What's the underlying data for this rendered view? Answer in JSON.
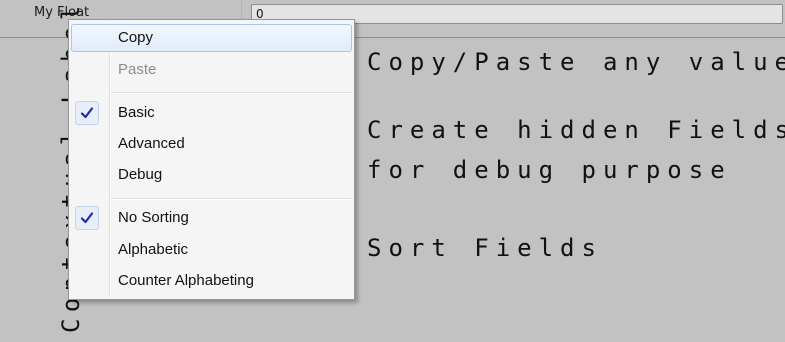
{
  "inspector": {
    "field_label": "My Float",
    "field_value": "0"
  },
  "vertical_title": "Contextual Labels",
  "captions": {
    "copy_paste": "Copy/Paste any value",
    "hidden_fields_line1": "Create hidden Fields",
    "hidden_fields_line2": "for debug purpose",
    "sort_fields": "Sort Fields"
  },
  "context_menu": {
    "copy": "Copy",
    "paste": "Paste",
    "basic": "Basic",
    "advanced": "Advanced",
    "debug": "Debug",
    "no_sorting": "No Sorting",
    "alphabetic": "Alphabetic",
    "counter_alphabeting": "Counter Alphabeting"
  },
  "colors": {
    "background": "#c2c2c2",
    "menu_background": "#f5f5f5",
    "checkmark": "#1b2fa8",
    "hover_border": "#a9c6ee"
  },
  "icons": {
    "check": "checkmark-icon"
  }
}
